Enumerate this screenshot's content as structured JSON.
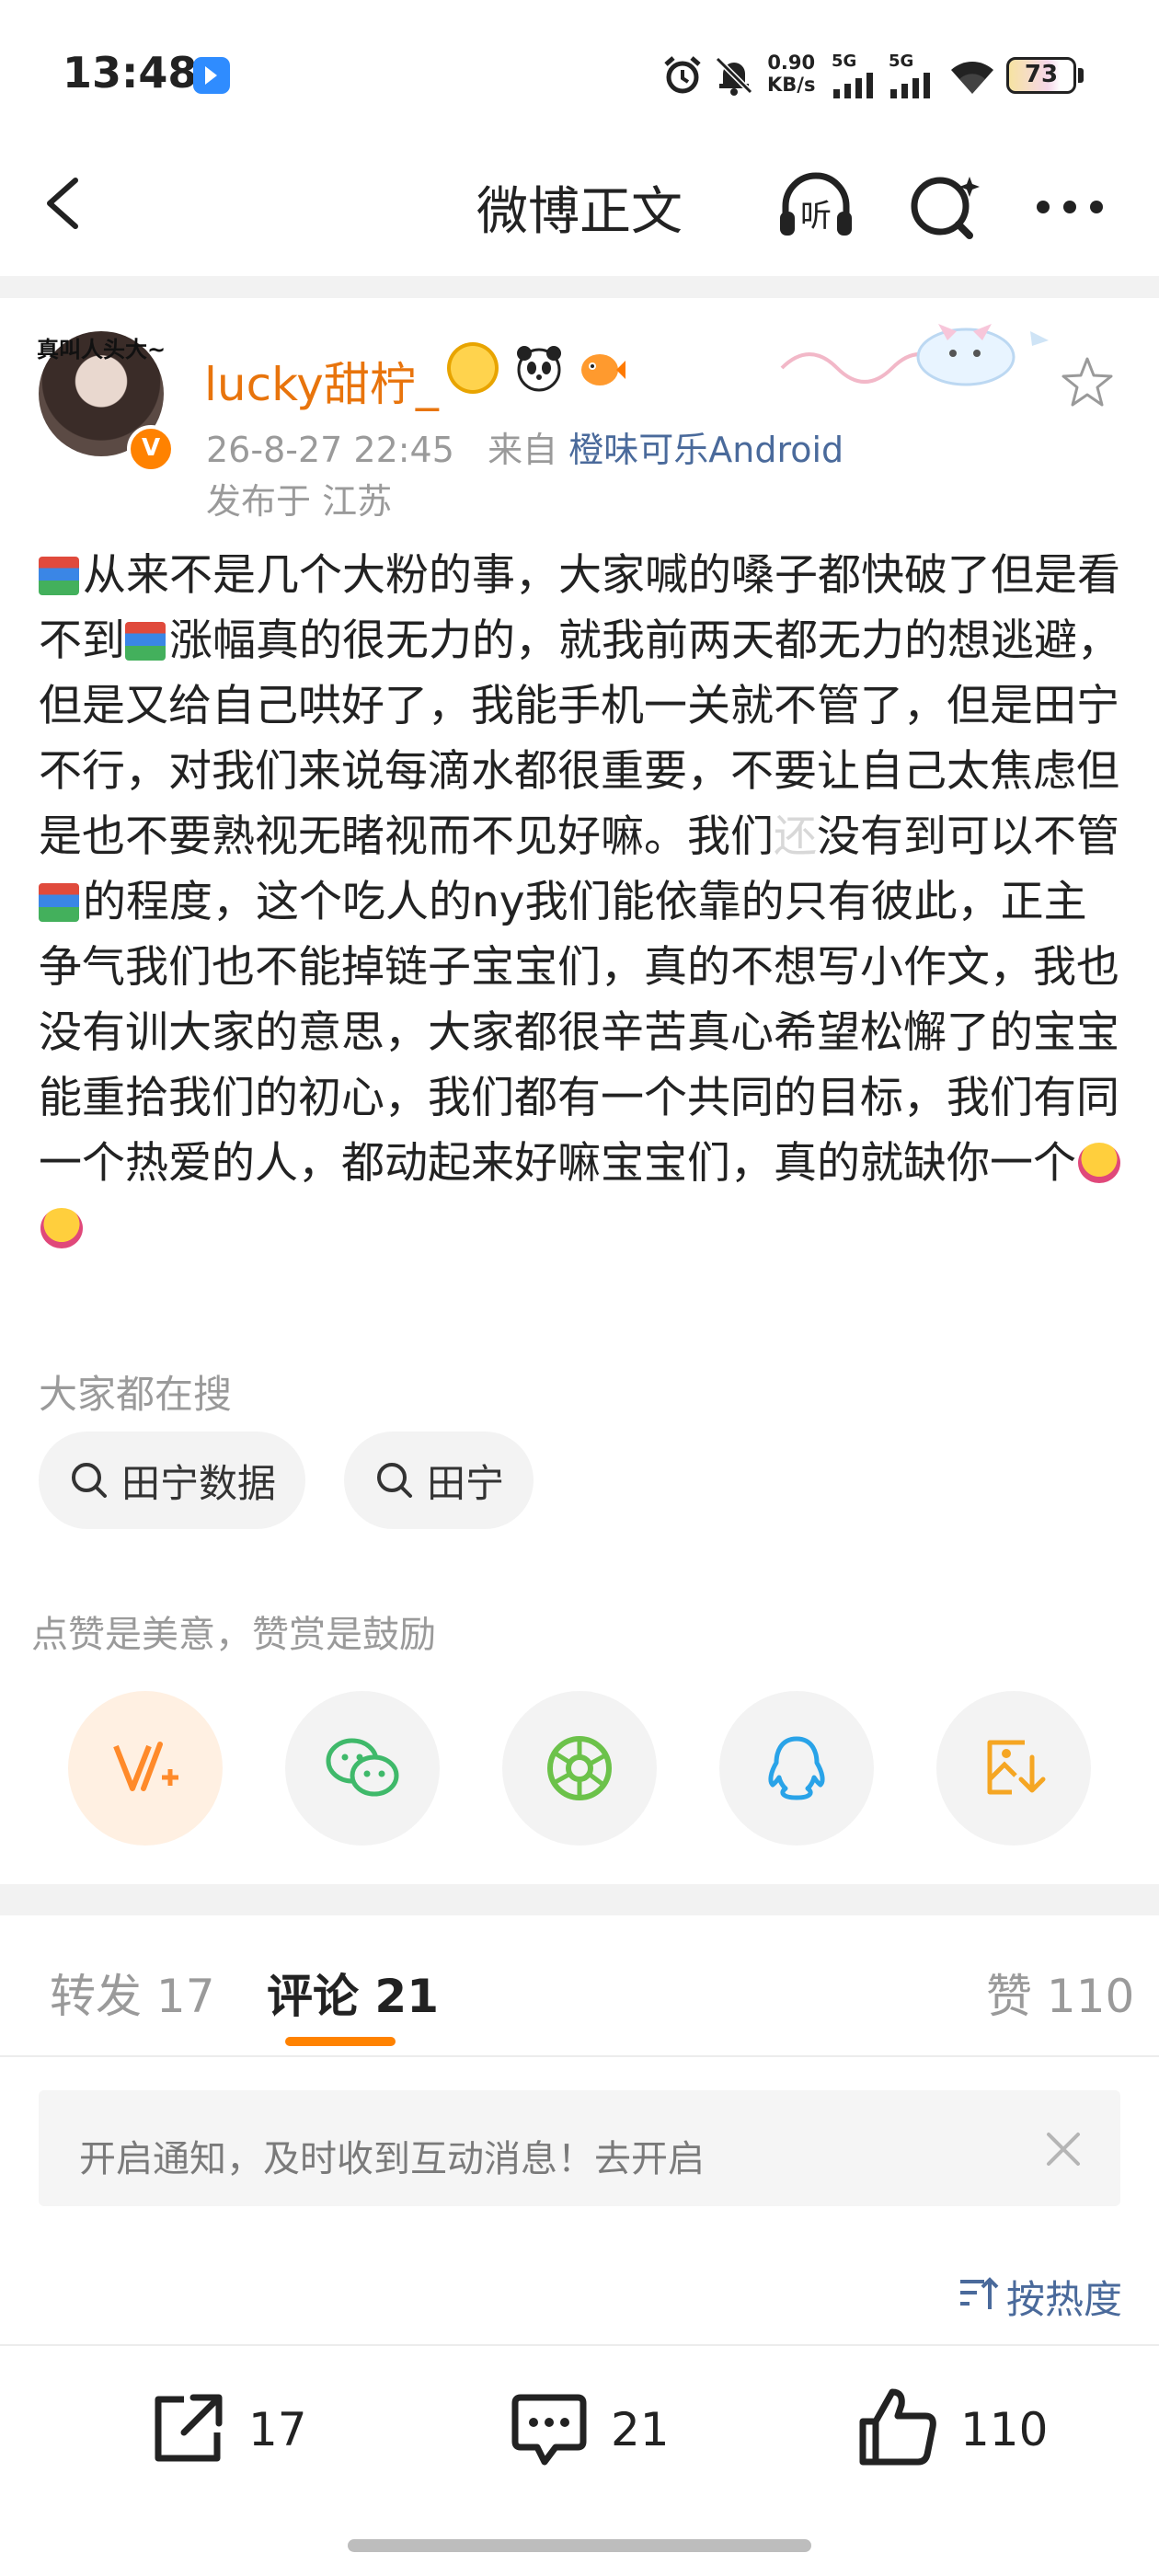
{
  "status_bar": {
    "time": "13:48",
    "net_speed_value": "0.90",
    "net_speed_unit": "KB/s",
    "signal1": "5G",
    "signal2": "5G",
    "battery": "73",
    "icons": [
      "app-notification-icon",
      "alarm-icon",
      "mute-bell-icon",
      "signal-icon",
      "wifi-icon",
      "battery-icon"
    ]
  },
  "header": {
    "title": "微博正文",
    "listen_icon_label": "听",
    "icons": [
      "back-icon",
      "listen-icon",
      "search-icon",
      "more-icon"
    ]
  },
  "post": {
    "avatar_tag": "真叫人头大~",
    "username": "lucky甜柠_",
    "time": "26-8-27 22:45",
    "source_prefix": "来自",
    "source": "橙味可乐Android",
    "location": "发布于 江苏",
    "body_segments": [
      "从来不是几个大粉的事，大家喊的嗓子都快破了但是看不到",
      "涨幅真的很无力的，就我前两天都无力的想逃避，但是又给自己哄好了，我能手机一关就不管了，但是田宁不行，对我们来说每滴水都很重要，不要让自己太焦虑但是也不要熟视无睹视而不见好嘛。我们",
      "没有到可以不管",
      "的程度，这个吃人的ny我们能依靠的只有彼此，正主争气我们也不能掉链子宝宝们，真的不想写小作文，我也没有训大家的意思，大家都很辛苦真心希望松懈了的宝宝能重拾我们的初心，我们都有一个共同的目标，我们有同一个热爱的人，都动起来好嘛宝宝们，真的就缺你一个"
    ],
    "body_hidden_char": "还"
  },
  "search": {
    "title": "大家都在搜",
    "chips": [
      "田宁数据",
      "田宁"
    ]
  },
  "reward": {
    "note": "点赞是美意，赞赏是鼓励",
    "share_targets": [
      "reward-icon",
      "wechat-icon",
      "moments-icon",
      "qq-icon",
      "save-image-icon"
    ]
  },
  "tabs": {
    "repost": "转发 17",
    "comment": "评论 21",
    "like": "赞 110",
    "active": "comment"
  },
  "notify": {
    "text": "开启通知，及时收到互动消息！去开启"
  },
  "sort": {
    "label": "按热度"
  },
  "actions": {
    "repost_count": "17",
    "comment_count": "21",
    "like_count": "110"
  },
  "colors": {
    "accent": "#ff8200",
    "username": "#e8740c",
    "link": "#4a6a9b",
    "muted": "#9a9a9a"
  }
}
